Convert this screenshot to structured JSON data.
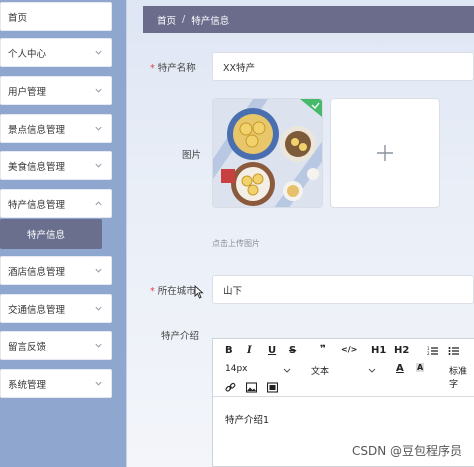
{
  "sidebar": {
    "items": [
      {
        "label": "首页",
        "has_chevron": false
      },
      {
        "label": "个人中心",
        "has_chevron": true
      },
      {
        "label": "用户管理",
        "has_chevron": true
      },
      {
        "label": "景点信息管理",
        "has_chevron": true
      },
      {
        "label": "美食信息管理",
        "has_chevron": true
      },
      {
        "label": "特产信息管理",
        "has_chevron": true
      },
      {
        "label": "特产信息",
        "has_chevron": false,
        "active": true
      },
      {
        "label": "酒店信息管理",
        "has_chevron": true
      },
      {
        "label": "交通信息管理",
        "has_chevron": true
      },
      {
        "label": "留言反馈",
        "has_chevron": true
      },
      {
        "label": "系统管理",
        "has_chevron": true
      }
    ]
  },
  "breadcrumb": {
    "home": "首页",
    "separator": "/",
    "current": "特产信息"
  },
  "form": {
    "name_label": "特产名称",
    "name_value": "XX特产",
    "image_label": "图片",
    "upload_hint": "点击上传图片",
    "city_label": "所在城市",
    "city_value": "山下",
    "intro_label": "特产介绍",
    "required_mark": "*"
  },
  "editor": {
    "font_size": "14px",
    "font_type": "文本",
    "heading1": "H1",
    "heading2": "H2",
    "align_label": "标准字",
    "content": "特产介绍1"
  },
  "watermark": "CSDN @豆包程序员",
  "colors": {
    "sidebar_bg": "#8fa6cf",
    "header_bg": "#6b6c8c",
    "active_item_bg": "#6a6f8d",
    "required": "#e0463f",
    "check_badge": "#46b96b"
  }
}
